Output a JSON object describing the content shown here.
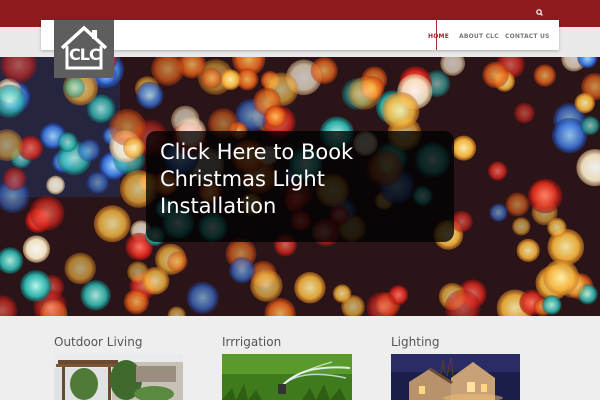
{
  "header": {
    "logo_text": "CLC",
    "nav": [
      {
        "label": "HOME",
        "active": true
      },
      {
        "label": "ABOUT CLC",
        "active": false
      },
      {
        "label": "CONTACT US",
        "active": false
      }
    ],
    "search_icon": "search-icon"
  },
  "hero": {
    "cta_text": "Click Here to Book\nChristmas Light\nInstallation"
  },
  "features": [
    {
      "title": "Outdoor Living",
      "image": "pergola-photo"
    },
    {
      "title": "Irrrigation",
      "image": "sprinkler-photo"
    },
    {
      "title": "Lighting",
      "image": "house-night-lighting-photo"
    }
  ],
  "colors": {
    "topbar": "#8f1b1f",
    "accent": "#a0262b",
    "logo_bg": "#5e5e5e",
    "nav_text": "#777777",
    "page_bg": "#eeeeee"
  }
}
